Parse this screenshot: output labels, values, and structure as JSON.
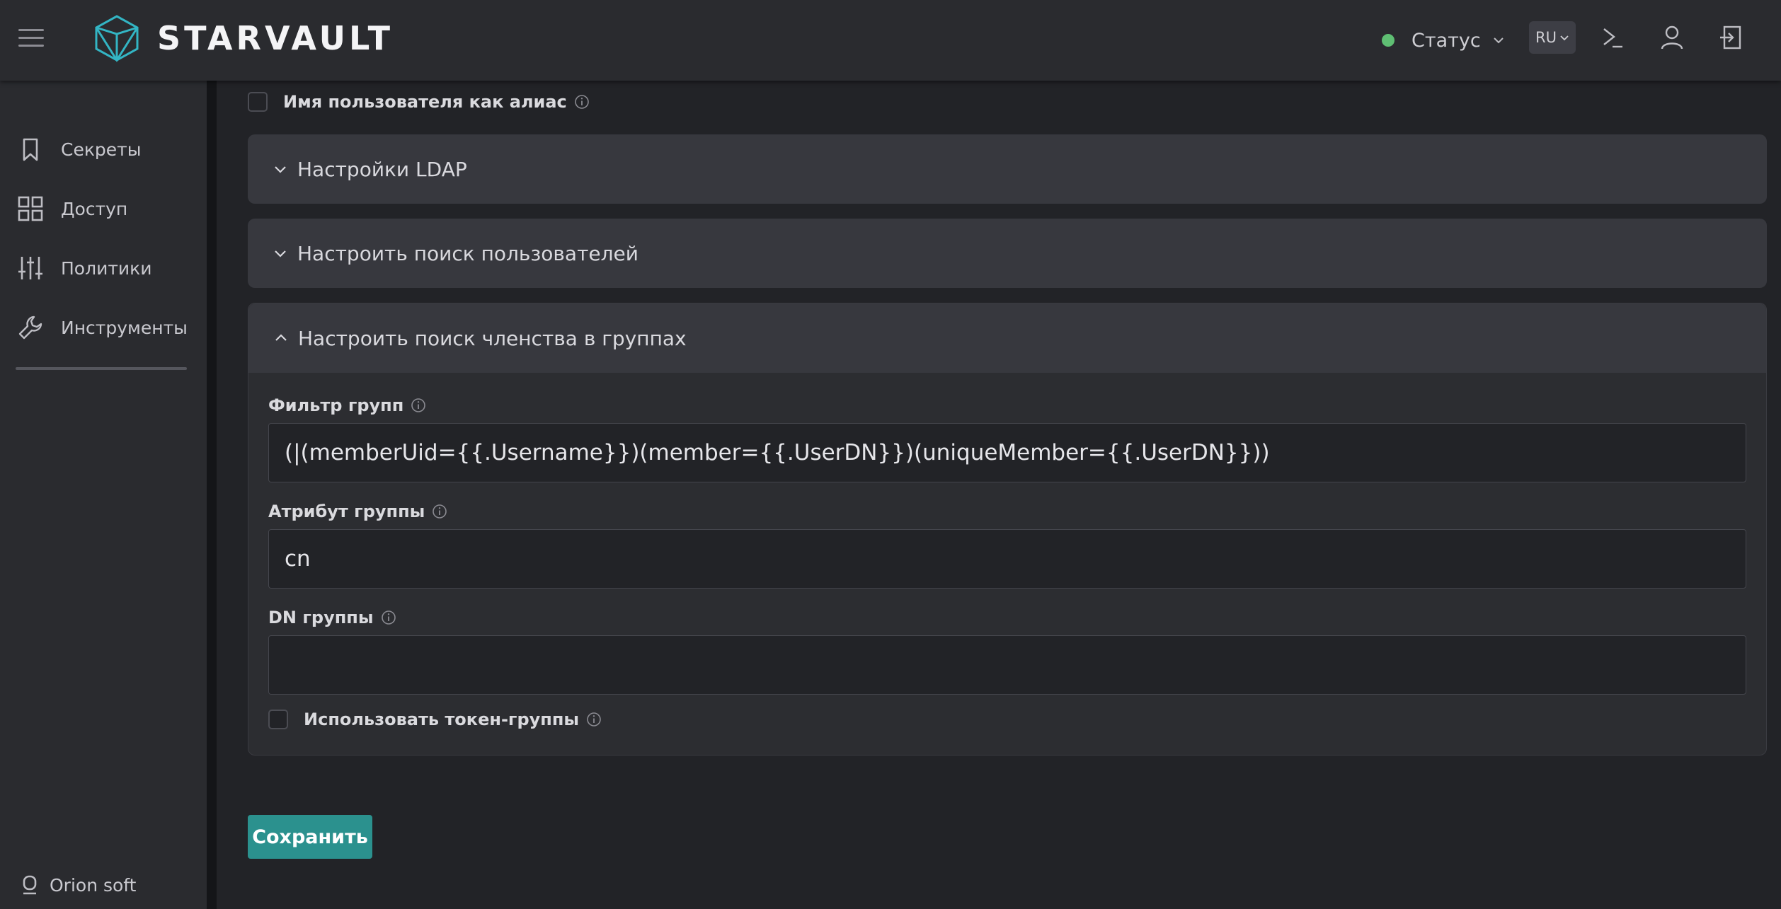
{
  "header": {
    "brand": "STARVAULT",
    "status_label": "Статус",
    "status_color": "#5fbf73",
    "lang": "RU",
    "icons": [
      "menu-icon",
      "terminal-icon",
      "user-icon",
      "logout-icon"
    ]
  },
  "sidebar": {
    "items": [
      {
        "label": "Секреты",
        "icon": "bookmark-icon"
      },
      {
        "label": "Доступ",
        "icon": "grid-icon"
      },
      {
        "label": "Политики",
        "icon": "sliders-icon"
      },
      {
        "label": "Инструменты",
        "icon": "wrench-icon"
      }
    ],
    "footer": "Orion soft"
  },
  "main": {
    "alias_checkbox_label": "Имя пользователя как алиас",
    "sections": [
      {
        "title": "Настройки LDAP",
        "expanded": false
      },
      {
        "title": "Настроить поиск пользователей",
        "expanded": false
      },
      {
        "title": "Настроить поиск членства в группах",
        "expanded": true
      }
    ],
    "group_filter": {
      "label": "Фильтр групп",
      "value": "(|(memberUid={{.Username}})(member={{.UserDN}})(uniqueMember={{.UserDN}}))"
    },
    "group_attr": {
      "label": "Атрибут группы",
      "value": "cn"
    },
    "group_dn": {
      "label": "DN группы",
      "value": ""
    },
    "token_groups_label": "Использовать токен-группы",
    "save_label": "Сохранить",
    "accent": "#2b918e"
  }
}
